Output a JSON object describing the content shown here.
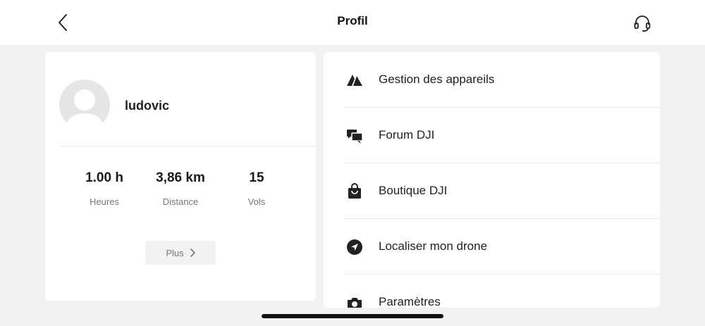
{
  "header": {
    "title": "Profil",
    "back_icon": "chevron-left-icon",
    "support_icon": "headset-icon"
  },
  "profile": {
    "username": "ludovic",
    "avatar_icon": "default-avatar-icon",
    "stats": {
      "hours": {
        "value": "1.00 h",
        "label": "Heures"
      },
      "distance": {
        "value": "3,86 km",
        "label": "Distance"
      },
      "flights": {
        "value": "15",
        "label": "Vols"
      }
    },
    "more_label": "Plus",
    "more_icon": "chevron-right-icon"
  },
  "menu": {
    "items": [
      {
        "label": "Gestion des appareils",
        "icon": "device-management-icon"
      },
      {
        "label": "Forum DJI",
        "icon": "forum-chat-icon"
      },
      {
        "label": "Boutique DJI",
        "icon": "shopping-bag-icon"
      },
      {
        "label": "Localiser mon drone",
        "icon": "locate-drone-icon"
      },
      {
        "label": "Paramètres",
        "icon": "camera-settings-icon"
      }
    ]
  },
  "colors": {
    "background": "#f2f2f2",
    "card": "#ffffff",
    "text_primary": "#222222",
    "text_secondary": "#777777",
    "divider": "#ececec"
  }
}
